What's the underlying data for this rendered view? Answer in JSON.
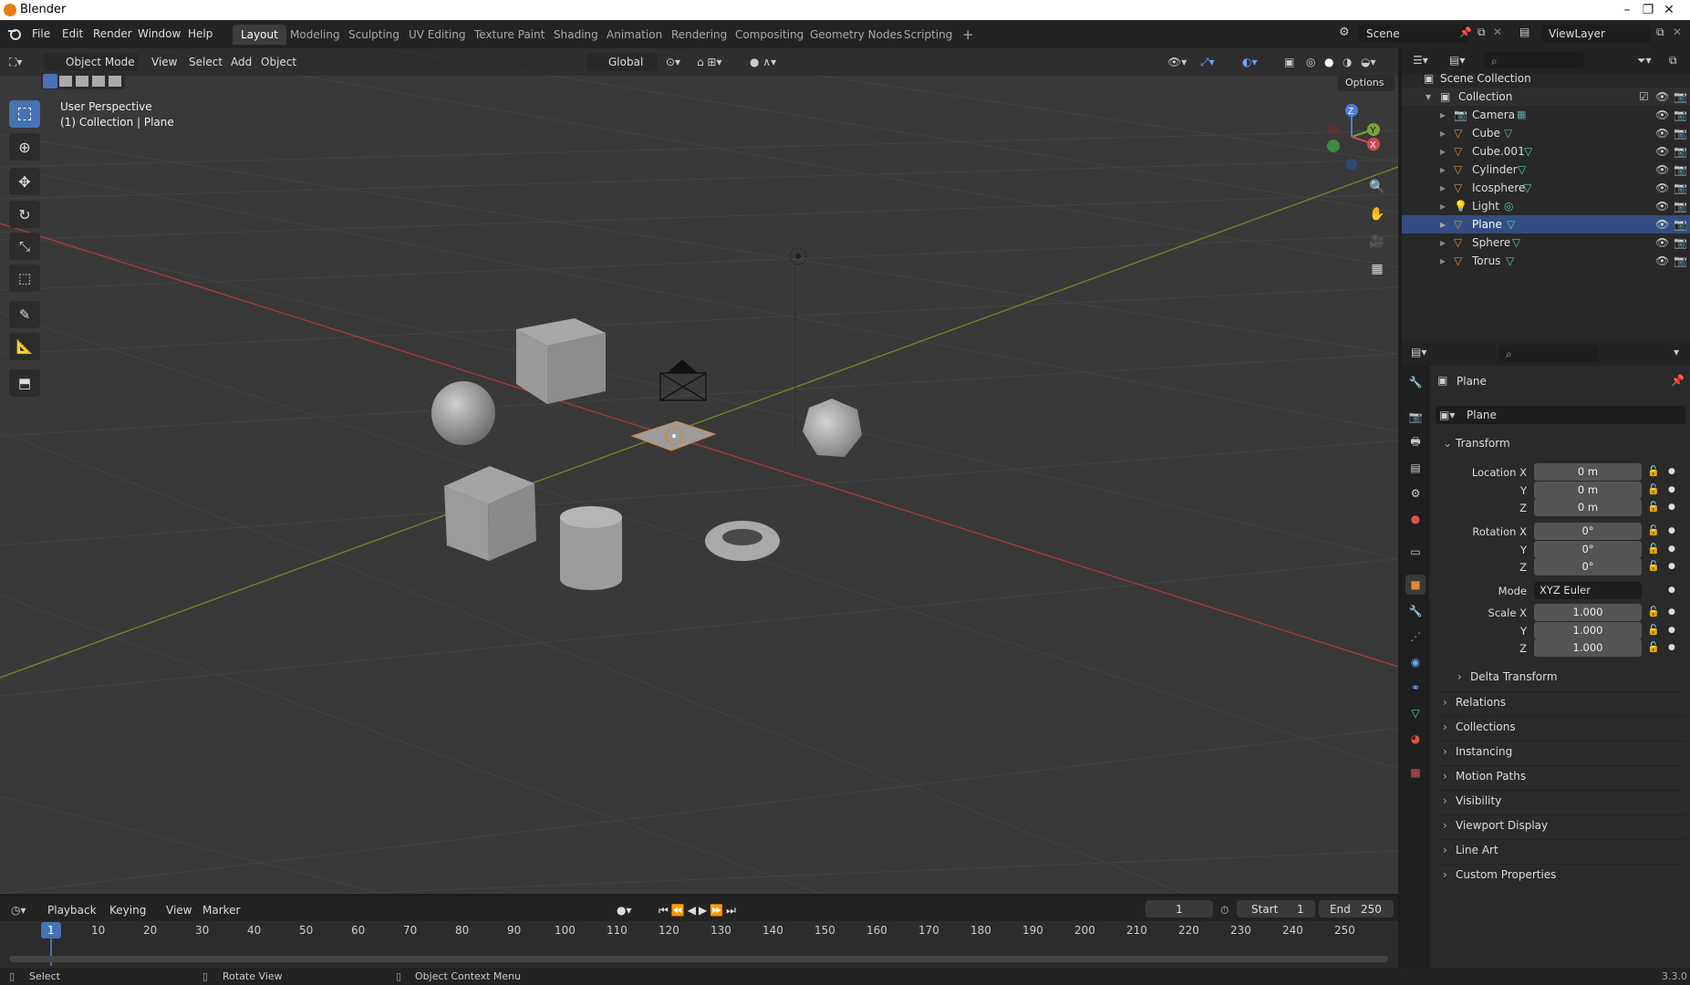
{
  "window": {
    "title": "Blender",
    "controls": [
      "–",
      "❐",
      "✕"
    ]
  },
  "menu": [
    "File",
    "Edit",
    "Render",
    "Window",
    "Help"
  ],
  "workspaces": [
    "Layout",
    "Modeling",
    "Sculpting",
    "UV Editing",
    "Texture Paint",
    "Shading",
    "Animation",
    "Rendering",
    "Compositing",
    "Geometry Nodes",
    "Scripting",
    "+"
  ],
  "active_workspace": "Layout",
  "scene": {
    "name": "Scene",
    "view_layer": "ViewLayer"
  },
  "viewport": {
    "mode": "Object Mode",
    "menus": [
      "View",
      "Select",
      "Add",
      "Object"
    ],
    "orientation": "Global",
    "options": "Options",
    "perspective": "User Perspective",
    "context": "(1) Collection | Plane",
    "gizmo_axes": {
      "x": "X",
      "y": "Y",
      "z": "Z"
    }
  },
  "outliner": {
    "root": "Scene Collection",
    "collection": "Collection",
    "items": [
      "Camera",
      "Cube",
      "Cube.001",
      "Cylinder",
      "Icosphere",
      "Light",
      "Plane",
      "Sphere",
      "Torus"
    ]
  },
  "properties": {
    "object_name": "Plane",
    "datablock": "Plane",
    "transform_title": "Transform",
    "location": {
      "label_x": "Location X",
      "label_y": "Y",
      "label_z": "Z",
      "x": "0 m",
      "y": "0 m",
      "z": "0 m"
    },
    "rotation": {
      "label_x": "Rotation X",
      "label_y": "Y",
      "label_z": "Z",
      "x": "0°",
      "y": "0°",
      "z": "0°"
    },
    "mode_label": "Mode",
    "mode_value": "XYZ Euler",
    "scale": {
      "label_x": "Scale X",
      "label_y": "Y",
      "label_z": "Z",
      "x": "1.000",
      "y": "1.000",
      "z": "1.000"
    },
    "delta": "Delta Transform",
    "panels": [
      "Relations",
      "Collections",
      "Instancing",
      "Motion Paths",
      "Visibility",
      "Viewport Display",
      "Line Art",
      "Custom Properties"
    ]
  },
  "timeline": {
    "menus": [
      "Playback",
      "Keying",
      "View",
      "Marker"
    ],
    "current_frame": "1",
    "start_label": "Start",
    "start": "1",
    "end_label": "End",
    "end": "250",
    "ticks": [
      "1",
      "10",
      "20",
      "30",
      "40",
      "50",
      "60",
      "70",
      "80",
      "90",
      "100",
      "110",
      "120",
      "130",
      "140",
      "150",
      "160",
      "170",
      "180",
      "190",
      "200",
      "210",
      "220",
      "230",
      "240",
      "250"
    ]
  },
  "statusbar": {
    "select": "Select",
    "rotate": "Rotate View",
    "context": "Object Context Menu",
    "version": "3.3.0"
  }
}
